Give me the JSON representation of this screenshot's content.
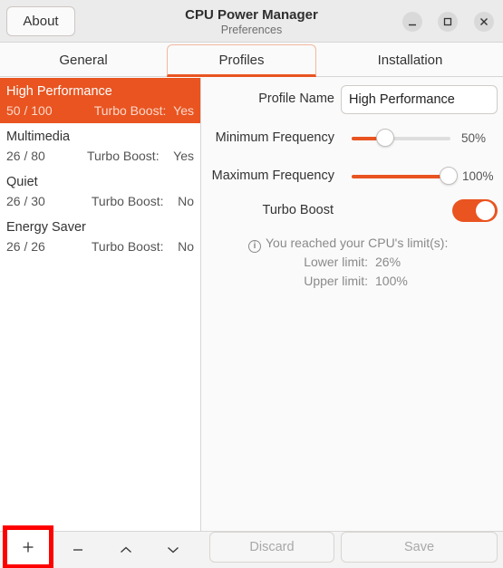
{
  "window": {
    "title": "CPU Power Manager",
    "subtitle": "Preferences",
    "about_label": "About"
  },
  "tabs": [
    {
      "label": "General",
      "active": false
    },
    {
      "label": "Profiles",
      "active": true
    },
    {
      "label": "Installation",
      "active": false
    }
  ],
  "profiles": [
    {
      "name": "High Performance",
      "range": "50 / 100",
      "turbo_label": "Turbo Boost:",
      "turbo": "Yes",
      "selected": true
    },
    {
      "name": "Multimedia",
      "range": "26 / 80",
      "turbo_label": "Turbo Boost:",
      "turbo": "Yes",
      "selected": false
    },
    {
      "name": "Quiet",
      "range": "26 / 30",
      "turbo_label": "Turbo Boost:",
      "turbo": "No",
      "selected": false
    },
    {
      "name": "Energy Saver",
      "range": "26 / 26",
      "turbo_label": "Turbo Boost:",
      "turbo": "No",
      "selected": false
    }
  ],
  "form": {
    "profile_name_label": "Profile Name",
    "profile_name_value": "High Performance",
    "min_freq_label": "Minimum Frequency",
    "min_freq_value": "50%",
    "min_freq_fraction": 0.5,
    "max_freq_label": "Maximum Frequency",
    "max_freq_value": "100%",
    "max_freq_fraction": 1.0,
    "turbo_label": "Turbo Boost",
    "turbo_on": true
  },
  "limits": {
    "message": "You reached your CPU's limit(s):",
    "lower_label": "Lower limit:",
    "lower_value": "26%",
    "upper_label": "Upper limit:",
    "upper_value": "100%"
  },
  "actions": {
    "discard_label": "Discard",
    "save_label": "Save"
  },
  "icons": {
    "add": "plus-icon",
    "remove": "minus-icon",
    "up": "chevron-up-icon",
    "down": "chevron-down-icon",
    "info": "info-icon"
  },
  "colors": {
    "accent": "#e95420",
    "highlight_border": "#ff0000"
  }
}
